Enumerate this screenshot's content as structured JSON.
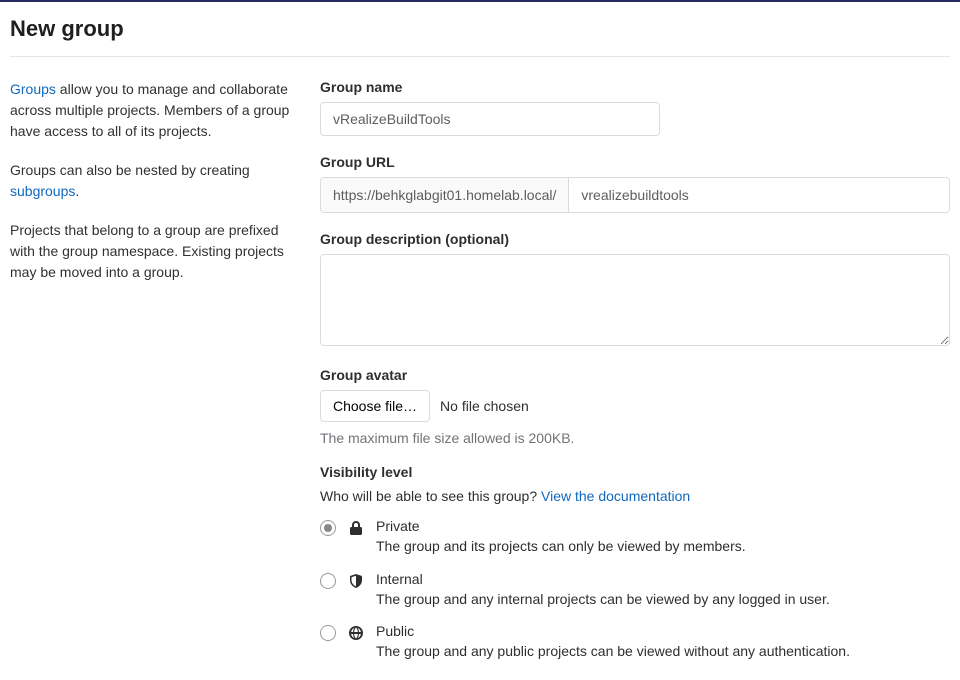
{
  "page": {
    "title": "New group"
  },
  "sidebar": {
    "p1a": "Groups",
    "p1b": " allow you to manage and collaborate across multiple projects. Members of a group have access to all of its projects.",
    "p2a": "Groups can also be nested by creating ",
    "p2b": "subgroups",
    "p2c": ".",
    "p3": "Projects that belong to a group are prefixed with the group namespace. Existing projects may be moved into a group."
  },
  "form": {
    "name_label": "Group name",
    "name_value": "vRealizeBuildTools",
    "url_label": "Group URL",
    "url_prefix": "https://behkglabgit01.homelab.local/",
    "url_slug": "vrealizebuildtools",
    "desc_label": "Group description (optional)",
    "desc_value": "",
    "avatar_label": "Group avatar",
    "choose_file": "Choose file…",
    "file_status": "No file chosen",
    "file_hint": "The maximum file size allowed is 200KB.",
    "visibility_label": "Visibility level",
    "visibility_q": "Who will be able to see this group? ",
    "visibility_doc": "View the documentation",
    "vis": [
      {
        "title": "Private",
        "desc": "The group and its projects can only be viewed by members."
      },
      {
        "title": "Internal",
        "desc": "The group and any internal projects can be viewed by any logged in user."
      },
      {
        "title": "Public",
        "desc": "The group and any public projects can be viewed without any authentication."
      }
    ]
  }
}
